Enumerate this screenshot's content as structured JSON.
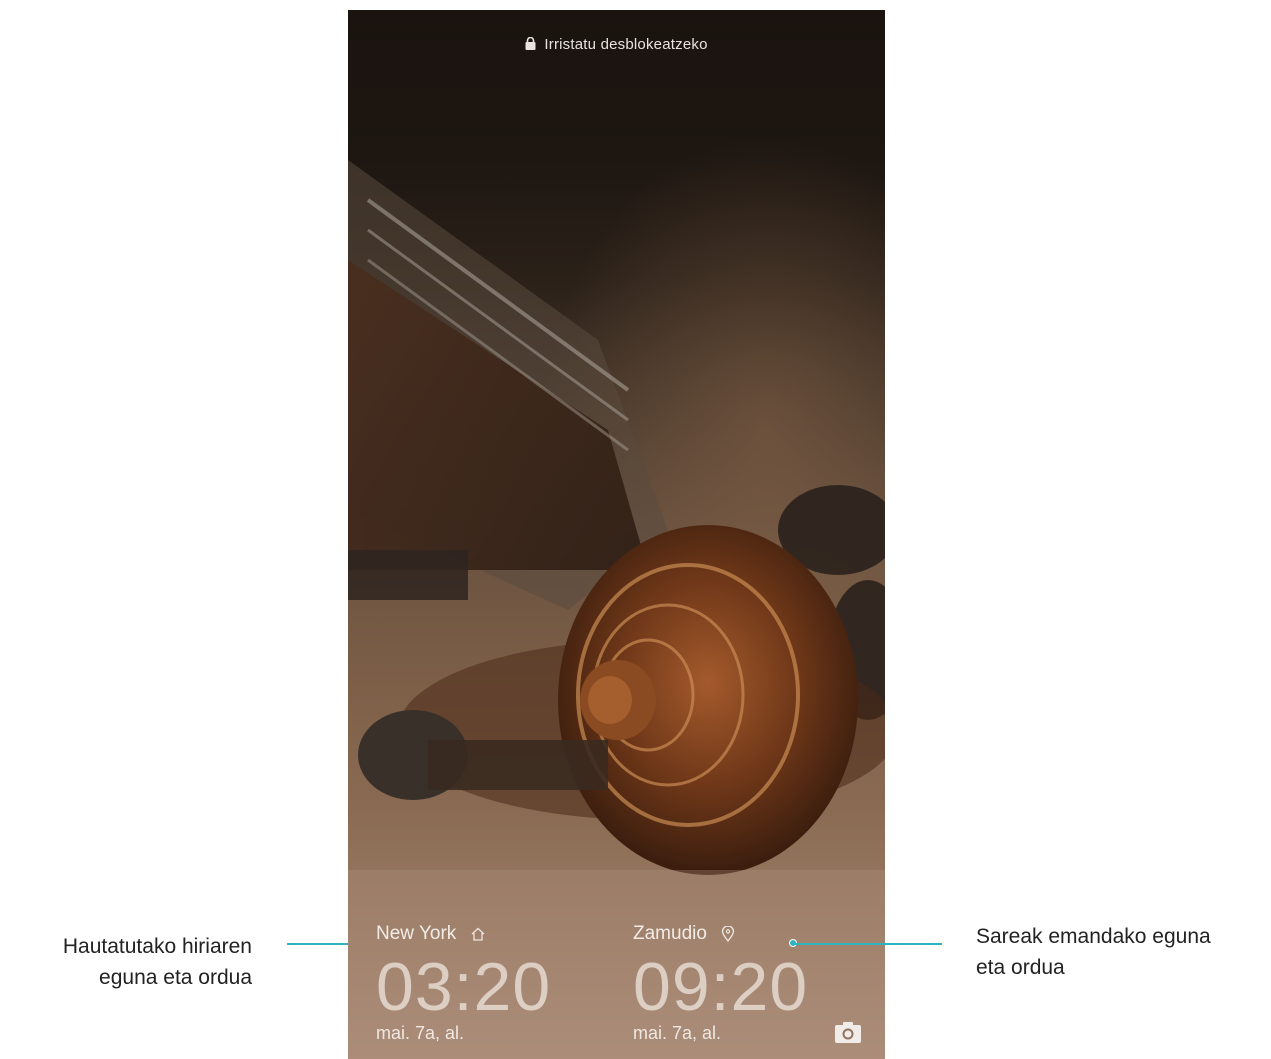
{
  "lockscreen": {
    "unlock_hint": "Irristatu desblokeatzeko",
    "home_city": {
      "city": "New York",
      "city_icon": "home-icon",
      "time": "03:20",
      "date": "mai. 7a, al."
    },
    "network_city": {
      "city": "Zamudio",
      "city_icon": "location-pin-icon",
      "time": "09:20",
      "date": "mai. 7a, al."
    },
    "camera_icon": "camera-icon"
  },
  "callouts": {
    "left_line1": "Hautatutako hiriaren",
    "left_line2": "eguna eta ordua",
    "right_line1": "Sareak emandako eguna",
    "right_line2": "eta ordua"
  },
  "colors": {
    "accent": "#2fb3c0"
  }
}
